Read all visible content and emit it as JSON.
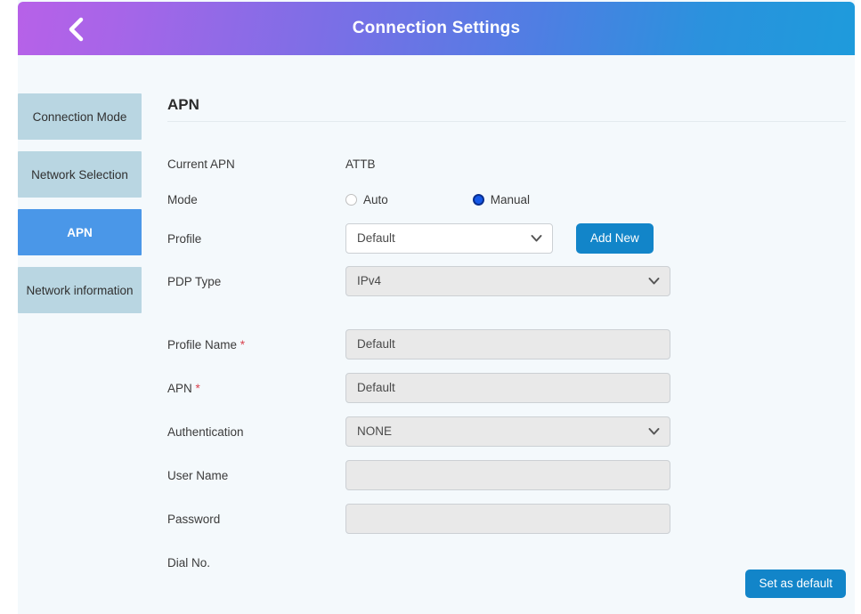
{
  "header": {
    "title": "Connection Settings",
    "back_icon": "chevron-left-icon",
    "gradient_start": "#b761e8",
    "gradient_end": "#1e9bdc"
  },
  "sidebar": {
    "items": [
      {
        "label": "Connection Mode",
        "active": false
      },
      {
        "label": "Network Selection",
        "active": false
      },
      {
        "label": "APN",
        "active": true
      },
      {
        "label": "Network information",
        "active": false
      }
    ],
    "item_bg": "#b9d6e2",
    "active_bg": "#4a97e8"
  },
  "main": {
    "section_title": "APN",
    "fields": {
      "current_apn": {
        "label": "Current APN",
        "value": "ATTB"
      },
      "mode": {
        "label": "Mode",
        "options": [
          {
            "label": "Auto",
            "checked": false
          },
          {
            "label": "Manual",
            "checked": true
          }
        ]
      },
      "profile": {
        "label": "Profile",
        "value": "Default",
        "caret": "chevron-down-icon",
        "add_button": "Add New"
      },
      "pdp_type": {
        "label": "PDP Type",
        "value": "IPv4",
        "caret": "chevron-down-icon"
      },
      "profile_name": {
        "label": "Profile Name",
        "required_mark": "*",
        "value": "Default"
      },
      "apn": {
        "label": "APN",
        "required_mark": "*",
        "value": "Default"
      },
      "authentication": {
        "label": "Authentication",
        "value": "NONE",
        "caret": "chevron-down-icon"
      },
      "user_name": {
        "label": "User Name",
        "value": ""
      },
      "password": {
        "label": "Password",
        "value": ""
      },
      "dial_no": {
        "label": "Dial No."
      }
    }
  },
  "footer": {
    "set_default_label": "Set as default",
    "button_color": "#1285c9"
  }
}
